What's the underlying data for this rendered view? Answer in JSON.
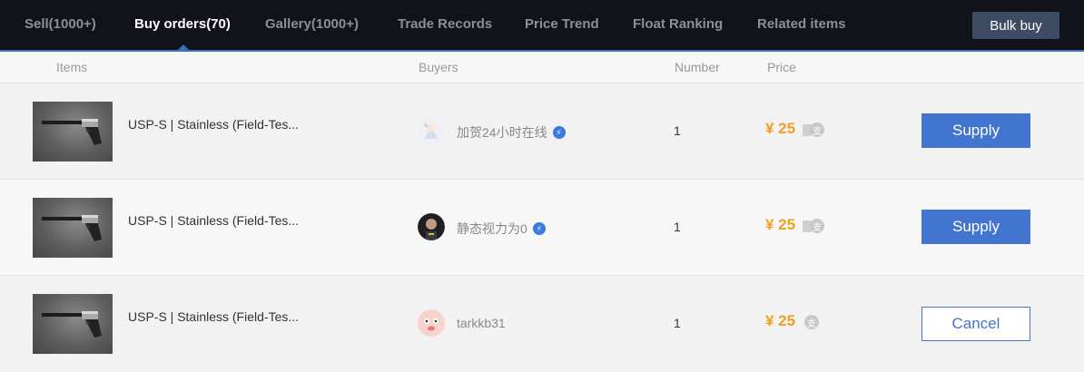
{
  "tabs": [
    {
      "label": "Sell(1000+)"
    },
    {
      "label": "Buy orders(70)"
    },
    {
      "label": "Gallery(1000+)"
    },
    {
      "label": "Trade Records"
    },
    {
      "label": "Price Trend"
    },
    {
      "label": "Float Ranking"
    },
    {
      "label": "Related items"
    }
  ],
  "active_tab": "Buy orders(70)",
  "bulk_buy_label": "Bulk buy",
  "table": {
    "headers": {
      "items": "Items",
      "buyers": "Buyers",
      "number": "Number",
      "price": "Price"
    },
    "rows": [
      {
        "item": "USP-S | Stainless (Field-Tes...",
        "buyer": "加贺24小时在线",
        "verified": true,
        "number": "1",
        "price": "¥ 25",
        "action": "Supply"
      },
      {
        "item": "USP-S | Stainless (Field-Tes...",
        "buyer": "静态视力为0",
        "verified": true,
        "number": "1",
        "price": "¥ 25",
        "action": "Supply"
      },
      {
        "item": "USP-S | Stainless (Field-Tes...",
        "buyer": "tarkkb31",
        "verified": false,
        "number": "1",
        "price": "¥ 25",
        "action": "Cancel"
      }
    ]
  },
  "colors": {
    "accent": "#4275cf",
    "price": "#f0a020",
    "topbar": "#12121a"
  }
}
